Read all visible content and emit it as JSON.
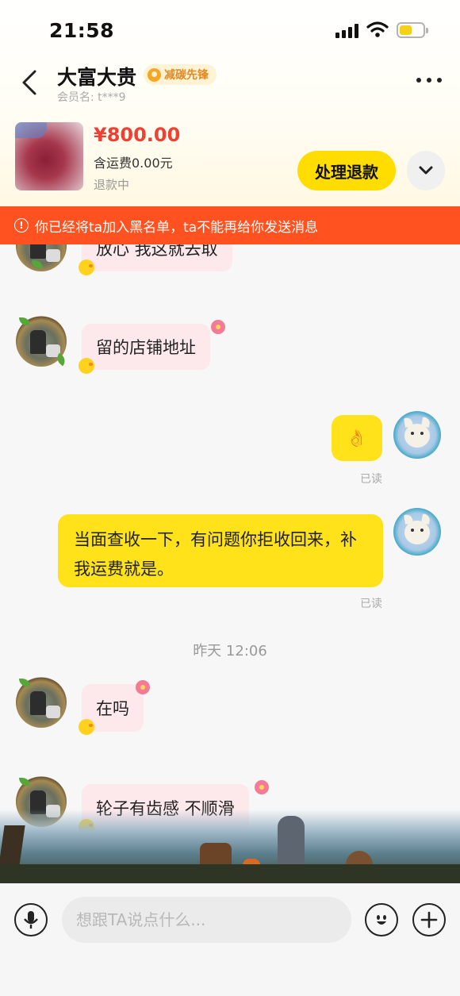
{
  "status_bar": {
    "time": "21:58"
  },
  "header": {
    "contact_name": "大富大贵",
    "badge_text": "减碳先锋",
    "member_label": "会员名:",
    "member_id": "t***9"
  },
  "order": {
    "price": "¥800.00",
    "shipping": "含运费0.00元",
    "status": "退款中",
    "refund_button": "处理退款"
  },
  "warning": {
    "text": "你已经将ta加入黑名单，ta不能再给你发送消息"
  },
  "messages": [
    {
      "side": "left",
      "text": "放心 我这就去取"
    },
    {
      "side": "left",
      "text": "留的店铺地址"
    },
    {
      "side": "right",
      "text": "👌",
      "read": "已读"
    },
    {
      "side": "right",
      "text": "当面查收一下，有问题你拒收回来，补我运费就是。",
      "read": "已读"
    },
    {
      "type": "time",
      "text": "昨天 12:06"
    },
    {
      "side": "left",
      "text": "在吗"
    },
    {
      "side": "left",
      "text": "轮子有齿感 不顺滑"
    }
  ],
  "input": {
    "placeholder": "想跟TA说点什么..."
  },
  "colors": {
    "accent": "#ffdd00",
    "warning": "#ff5220",
    "price": "#ef4031",
    "bubble_left": "#fde9ec"
  },
  "icons": {
    "back": "chevron-left-icon",
    "more": "more-dots-icon",
    "expand": "chevron-down-icon",
    "warning": "info-circle-icon",
    "voice": "microphone-icon",
    "emoji": "smiley-icon",
    "plus": "plus-circle-icon"
  }
}
